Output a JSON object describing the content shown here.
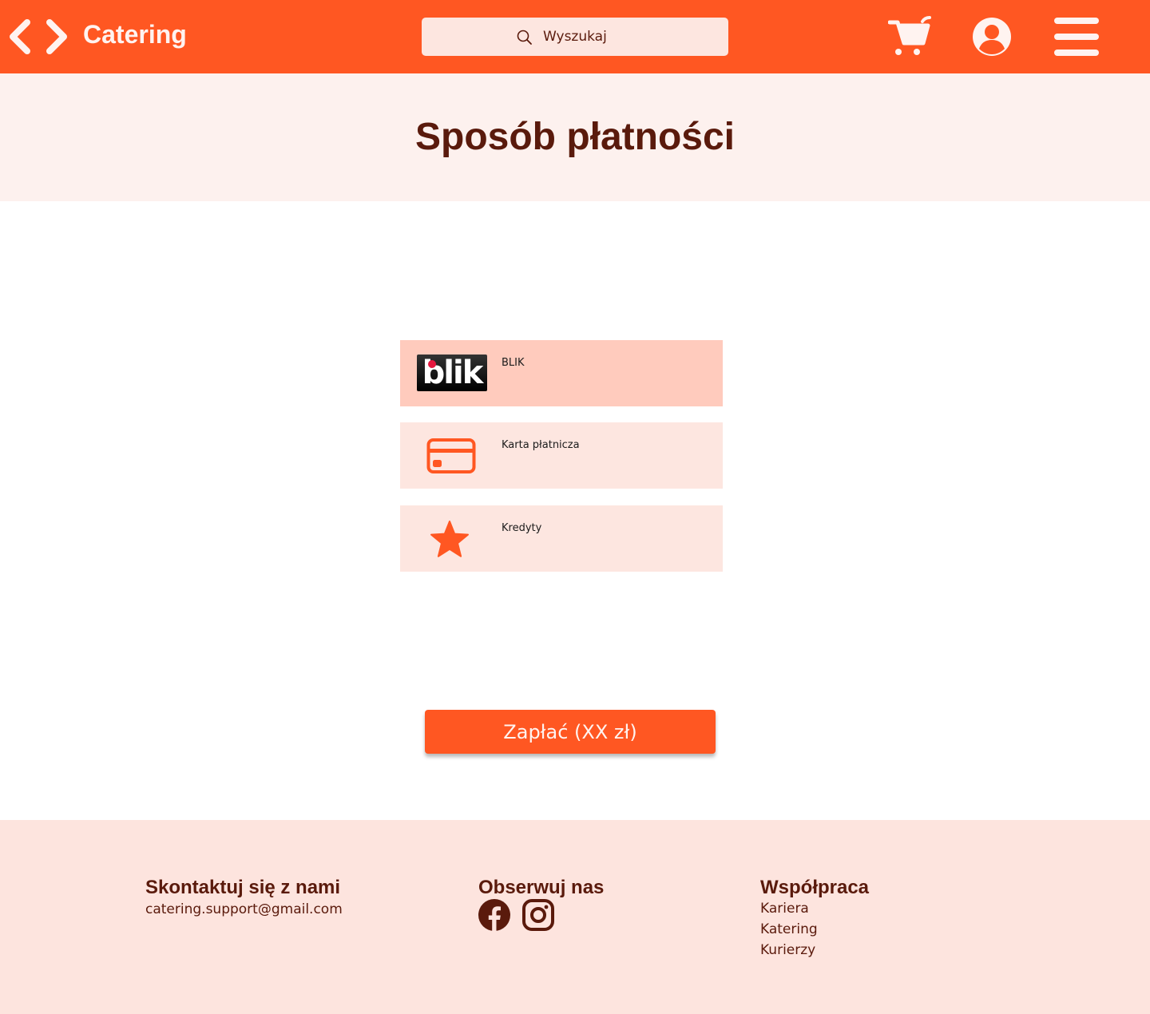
{
  "header": {
    "brand": "Catering",
    "search_placeholder": "Wyszukaj",
    "icons": [
      "back-arrow-icon",
      "forward-arrow-icon",
      "search-icon",
      "cart-icon",
      "user-icon",
      "menu-icon"
    ]
  },
  "page": {
    "title": "Sposób płatności"
  },
  "payment_options": [
    {
      "label": "BLIK",
      "logo_text": "blik",
      "icon": "blik-logo",
      "selected": true
    },
    {
      "label": "Karta płatnicza",
      "icon": "credit-card-icon",
      "selected": false
    },
    {
      "label": "Kredyty",
      "icon": "star-icon",
      "selected": false
    }
  ],
  "pay_button": {
    "label": "Zapłać (XX zł)"
  },
  "footer": {
    "contact": {
      "heading": "Skontaktuj się z nami",
      "email": "catering.support@gmail.com"
    },
    "follow": {
      "heading": "Obserwuj nas",
      "icons": [
        "facebook-icon",
        "instagram-icon"
      ]
    },
    "cooperation": {
      "heading": "Współpraca",
      "links": [
        "Kariera",
        "Katering",
        "Kurierzy"
      ]
    }
  },
  "colors": {
    "primary": "#ff5722",
    "dark_text": "#5a1a0c",
    "header_light": "#fff3f0",
    "option_bg": "#fde6e0",
    "option_selected_bg": "#ffcbbd",
    "title_band_bg": "#fdf1ee",
    "footer_bg": "#fde4de"
  }
}
